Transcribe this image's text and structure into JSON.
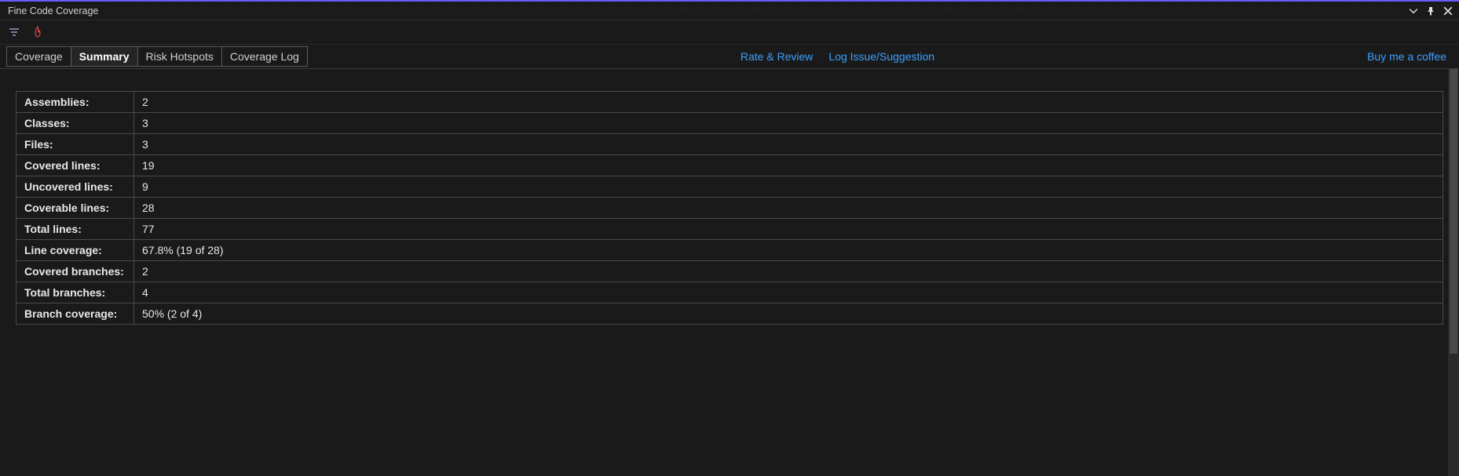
{
  "window": {
    "title": "Fine Code Coverage"
  },
  "tabs": [
    {
      "label": "Coverage",
      "active": false
    },
    {
      "label": "Summary",
      "active": true
    },
    {
      "label": "Risk Hotspots",
      "active": false
    },
    {
      "label": "Coverage Log",
      "active": false
    }
  ],
  "links": {
    "rate": "Rate & Review",
    "log_issue": "Log Issue/Suggestion",
    "coffee": "Buy me a coffee"
  },
  "summary": {
    "rows": [
      {
        "label": "Assemblies:",
        "value": "2"
      },
      {
        "label": "Classes:",
        "value": "3"
      },
      {
        "label": "Files:",
        "value": "3"
      },
      {
        "label": "Covered lines:",
        "value": "19"
      },
      {
        "label": "Uncovered lines:",
        "value": "9"
      },
      {
        "label": "Coverable lines:",
        "value": "28"
      },
      {
        "label": "Total lines:",
        "value": "77"
      },
      {
        "label": "Line coverage:",
        "value": "67.8% (19 of 28)"
      },
      {
        "label": "Covered branches:",
        "value": "2"
      },
      {
        "label": "Total branches:",
        "value": "4"
      },
      {
        "label": "Branch coverage:",
        "value": "50% (2 of 4)"
      }
    ]
  }
}
